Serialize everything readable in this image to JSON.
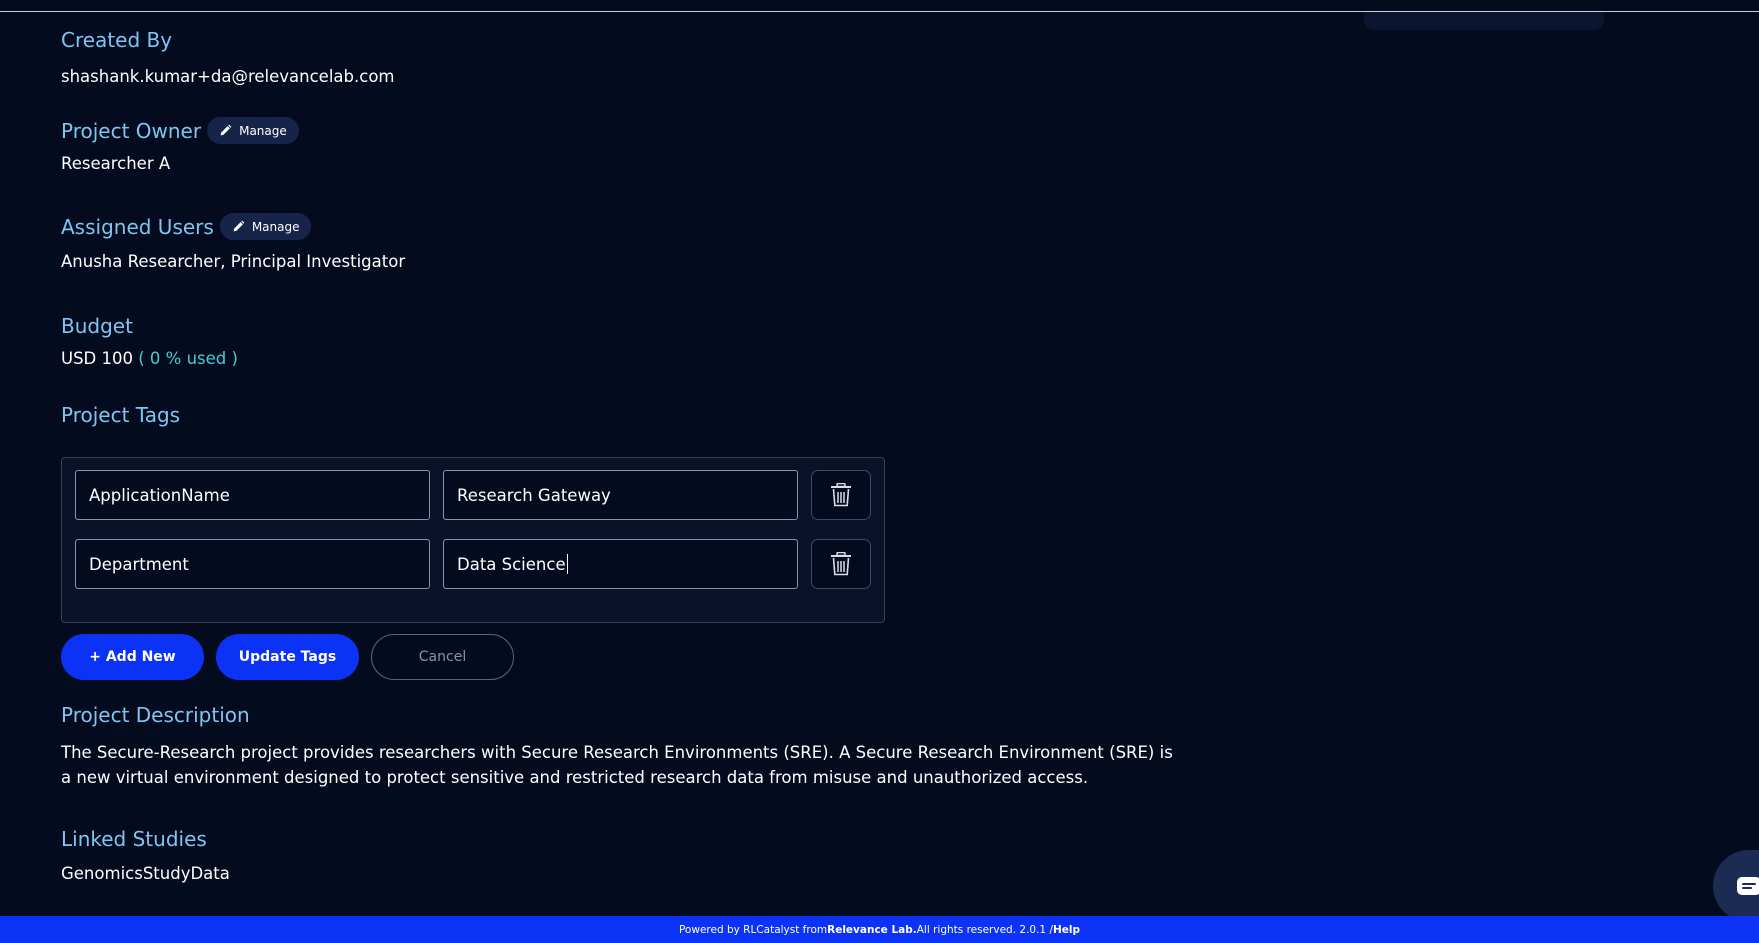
{
  "created_by": {
    "title": "Created By",
    "value": "shashank.kumar+da@relevancelab.com"
  },
  "project_owner": {
    "title": "Project Owner",
    "manage_label": "Manage",
    "value": "Researcher A"
  },
  "assigned_users": {
    "title": "Assigned Users",
    "manage_label": "Manage",
    "value": "Anusha Researcher, Principal Investigator"
  },
  "budget": {
    "title": "Budget",
    "amount": "USD 100",
    "used": "( 0 % used )"
  },
  "project_tags": {
    "title": "Project Tags",
    "rows": [
      {
        "key": "ApplicationName",
        "value": "Research Gateway"
      },
      {
        "key": "Department",
        "value": "Data Science"
      }
    ],
    "add_label": "+ Add New",
    "update_label": "Update Tags",
    "cancel_label": "Cancel"
  },
  "project_description": {
    "title": "Project Description",
    "text": "The Secure-Research project provides researchers with Secure Research Environments (SRE). A Secure Research Environment (SRE) is a new virtual environment designed to protect sensitive and restricted research data from misuse and unauthorized access."
  },
  "linked_studies": {
    "title": "Linked Studies",
    "value": "GenomicsStudyData"
  },
  "footer": {
    "prefix": "Powered by RLCatalyst from ",
    "brand": "Relevance Lab.",
    "middle": " All rights reserved. 2.0.1 / ",
    "help": "Help"
  },
  "icons": {
    "manage": "pencil-icon",
    "delete": "trash-icon",
    "chat": "chat-icon"
  },
  "colors": {
    "background": "#050b1f",
    "heading": "#7ec6f0",
    "accent": "#0c33f5",
    "budget_used": "#3fd0cf"
  }
}
